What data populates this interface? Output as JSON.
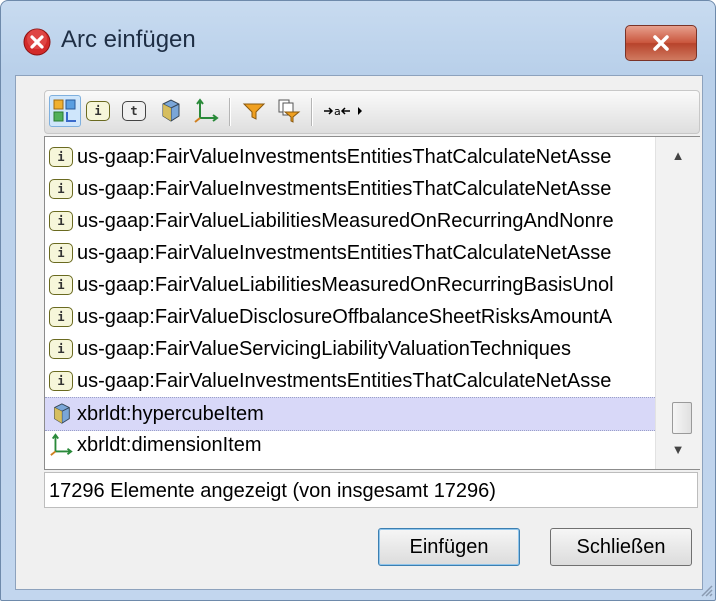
{
  "window": {
    "title": "Arc einfügen"
  },
  "toolbar": {
    "buttons": [
      {
        "icon": "all-elements-icon",
        "active": true
      },
      {
        "icon": "item-icon"
      },
      {
        "icon": "tuple-icon"
      },
      {
        "icon": "hypercube-icon"
      },
      {
        "icon": "dimension-icon"
      },
      {
        "icon": "filter-icon"
      },
      {
        "icon": "filter-copy-icon"
      },
      {
        "icon": "expand-collapse-icon"
      }
    ]
  },
  "list": {
    "rows": [
      {
        "icon": "item",
        "label": "us-gaap:FairValueInvestmentsEntitiesThatCalculateNetAsse"
      },
      {
        "icon": "item",
        "label": "us-gaap:FairValueInvestmentsEntitiesThatCalculateNetAsse"
      },
      {
        "icon": "item",
        "label": "us-gaap:FairValueLiabilitiesMeasuredOnRecurringAndNonre"
      },
      {
        "icon": "item",
        "label": "us-gaap:FairValueInvestmentsEntitiesThatCalculateNetAsse"
      },
      {
        "icon": "item",
        "label": "us-gaap:FairValueLiabilitiesMeasuredOnRecurringBasisUnol"
      },
      {
        "icon": "item",
        "label": "us-gaap:FairValueDisclosureOffbalanceSheetRisksAmountA"
      },
      {
        "icon": "item",
        "label": "us-gaap:FairValueServicingLiabilityValuationTechniques"
      },
      {
        "icon": "item",
        "label": "us-gaap:FairValueInvestmentsEntitiesThatCalculateNetAsse"
      },
      {
        "icon": "hypercube",
        "label": "xbrldt:hypercubeItem",
        "selected": true
      },
      {
        "icon": "dimension",
        "label": "xbrldt:dimensionItem"
      }
    ],
    "item_icon_text": "i"
  },
  "status": {
    "text": "17296 Elemente angezeigt (von insgesamt 17296)"
  },
  "buttons": {
    "insert": "Einfügen",
    "close": "Schließen"
  },
  "colors": {
    "selection": "#d8d8f8",
    "title_text": "#1e2e44",
    "close_red": "#c9553c"
  }
}
